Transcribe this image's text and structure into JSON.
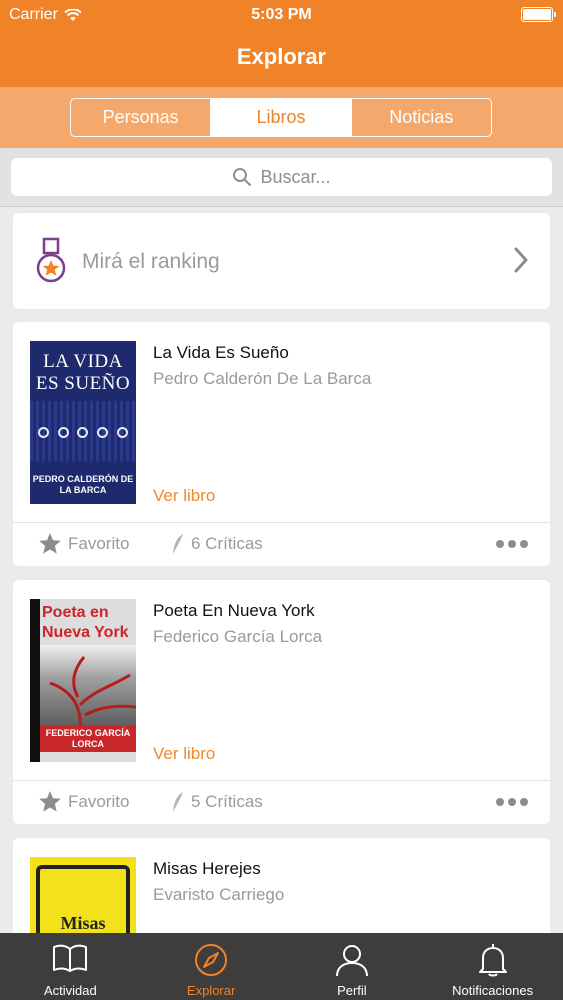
{
  "status": {
    "carrier": "Carrier",
    "time": "5:03 PM"
  },
  "nav": {
    "title": "Explorar"
  },
  "segments": [
    {
      "label": "Personas",
      "active": false
    },
    {
      "label": "Libros",
      "active": true
    },
    {
      "label": "Noticias",
      "active": false
    }
  ],
  "search": {
    "placeholder": "Buscar..."
  },
  "ranking": {
    "label": "Mirá el ranking"
  },
  "books": [
    {
      "title": "La Vida Es Sueño",
      "author": "Pedro Calderón De La Barca",
      "link": "Ver libro",
      "favorite": "Favorito",
      "critics": "6 Críticas",
      "cover_title": "LA VIDA ES SUEÑO",
      "cover_author": "PEDRO CALDERÓN DE LA BARCA"
    },
    {
      "title": "Poeta En Nueva York",
      "author": "Federico García Lorca",
      "link": "Ver libro",
      "favorite": "Favorito",
      "critics": "5 Críticas",
      "cover_title": "Poeta en Nueva York",
      "cover_author": "FEDERICO GARCÍA LORCA"
    },
    {
      "title": "Misas Herejes",
      "author": "Evaristo Carriego",
      "cover_title": "Misas"
    }
  ],
  "tabbar": [
    {
      "label": "Actividad",
      "icon": "book-icon",
      "active": false
    },
    {
      "label": "Explorar",
      "icon": "compass-icon",
      "active": true
    },
    {
      "label": "Perfil",
      "icon": "person-icon",
      "active": false
    },
    {
      "label": "Notificaciones",
      "icon": "bell-icon",
      "active": false
    }
  ],
  "colors": {
    "accent": "#f08327",
    "segment_bg": "#f5a86b",
    "tabbar_bg": "#3d3d3d"
  }
}
